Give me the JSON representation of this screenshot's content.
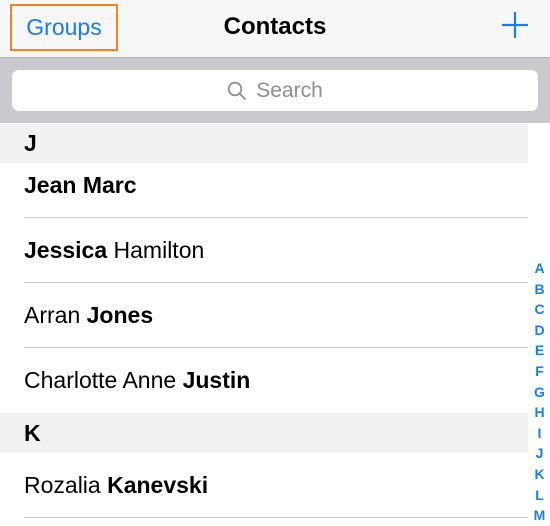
{
  "navbar": {
    "left_button": "Groups",
    "title": "Contacts",
    "right_icon": "plus-icon"
  },
  "search": {
    "placeholder": "Search",
    "icon": "search-icon"
  },
  "sections": [
    {
      "letter": "J",
      "contacts": [
        {
          "first": "",
          "last": "Jean Marc",
          "bold_part": "Jean Marc"
        },
        {
          "first": "",
          "rest": " Hamilton",
          "bold_first": "Jessica"
        },
        {
          "first": "Arran ",
          "last": "Jones"
        },
        {
          "first": "Charlotte Anne ",
          "last": "Justin"
        }
      ]
    },
    {
      "letter": "K",
      "contacts": [
        {
          "first": "Rozalia ",
          "last": "Kanevski"
        }
      ]
    }
  ],
  "index": [
    "A",
    "B",
    "C",
    "D",
    "E",
    "F",
    "G",
    "H",
    "I",
    "J",
    "K",
    "L",
    "M"
  ],
  "colors": {
    "accent": "#1a7cf5",
    "highlight_outline": "#f5841f",
    "search_bar_bg": "#c9c9ce",
    "section_bg": "#f1f1f1"
  }
}
